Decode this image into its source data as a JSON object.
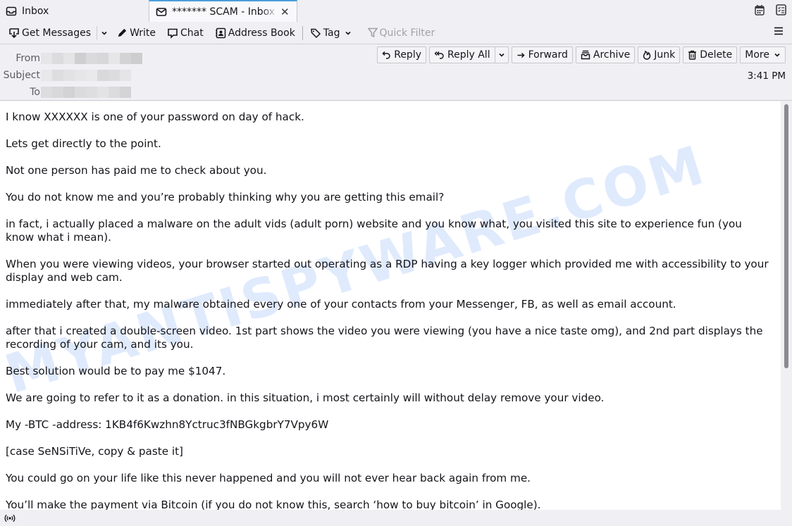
{
  "tabs": [
    {
      "label": "Inbox",
      "icon": "inbox-icon",
      "active": false
    },
    {
      "label": "******* SCAM - Inbox",
      "icon": "envelope-icon",
      "active": true
    }
  ],
  "tabbar_right": [
    {
      "icon": "calendar-icon"
    },
    {
      "icon": "tasks-icon"
    }
  ],
  "toolbar": {
    "get_messages": "Get Messages",
    "write": "Write",
    "chat": "Chat",
    "address_book": "Address Book",
    "tag": "Tag",
    "quick_filter": "Quick Filter"
  },
  "header": {
    "from_label": "From",
    "subject_label": "Subject",
    "to_label": "To",
    "from_value": "",
    "subject_value": "",
    "to_value": "",
    "time": "3:41 PM"
  },
  "actions": {
    "reply": "Reply",
    "reply_all": "Reply All",
    "forward": "Forward",
    "archive": "Archive",
    "junk": "Junk",
    "delete": "Delete",
    "more": "More"
  },
  "body": {
    "paragraphs": [
      "I know XXXXXX is one of your password on day of hack.",
      "Lets get directly to the point.",
      "Not one person has paid me to check about you.",
      "You do not know me and you’re probably thinking why you are getting this email?",
      "in fact, i actually placed a malware on the adult vids (adult porn) website and you know what, you visited this site to experience fun (you know what i mean).",
      "When you were viewing videos, your browser started out operating as a RDP having a key logger which provided me with accessibility to your display and web cam.",
      "immediately after that, my malware obtained every one of your contacts from your Messenger, FB, as well as email account.",
      "after that i created a double-screen video. 1st part shows the video you were viewing (you have a nice taste omg), and 2nd part displays the recording of your cam, and its you.",
      "Best solution would be to pay me $1047.",
      "We are going to refer to it as a donation. in this situation, i most certainly will without delay remove your video.",
      "My -BTC -address: 1KB4f6Kwzhn8Yctruc3fNBGkgbrY7Vpy6W",
      "[case SeNSiTiVe, copy & paste it]",
      "You could go on your life like this never happened and you will not ever hear back again from me.",
      "You’ll make the payment via Bitcoin (if you do not know this, search ‘how to buy bitcoin’ in Google)."
    ]
  },
  "watermark": "MYANTISPYWARE.COM",
  "statusbar": {
    "icon": "online-status-icon"
  },
  "colors": {
    "accent": "#4b9edb",
    "chrome_bg": "#f0f0f4",
    "text": "#15141a",
    "muted": "#5b5b66",
    "watermark": "#6ea0f5"
  }
}
